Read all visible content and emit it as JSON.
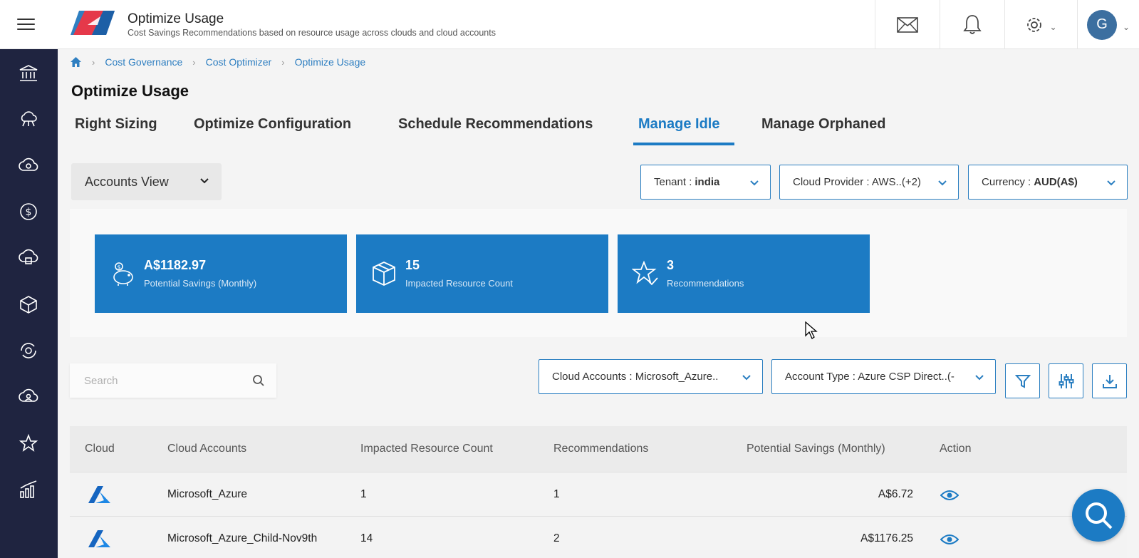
{
  "header": {
    "title": "Optimize Usage",
    "subtitle": "Cost Savings Recommendations based on resource usage across clouds and cloud accounts",
    "avatar_initial": "G",
    "icons": [
      "menu-icon",
      "mail-icon",
      "bell-icon",
      "gear-icon",
      "chevron-down-icon"
    ]
  },
  "sidebar": {
    "items": [
      "bank-icon",
      "cloud-network-icon",
      "cloud-cog-icon",
      "dollar-icon",
      "cloud-lock-icon",
      "cube-icon",
      "cog-refresh-icon",
      "cloud-user-icon",
      "star-icon",
      "bar-chart-icon"
    ]
  },
  "breadcrumb": {
    "items": [
      "Cost Governance",
      "Cost Optimizer",
      "Optimize Usage"
    ]
  },
  "page": {
    "title": "Optimize Usage"
  },
  "tabs": [
    {
      "label": "Right Sizing",
      "active": false
    },
    {
      "label": "Optimize Configuration",
      "active": false
    },
    {
      "label": "Schedule Recommendations",
      "active": false
    },
    {
      "label": "Manage Idle",
      "active": true
    },
    {
      "label": "Manage Orphaned",
      "active": false
    }
  ],
  "view_select": {
    "value": "Accounts View"
  },
  "filters": {
    "tenant_label": "Tenant :",
    "tenant_value": "india",
    "provider_label": "Cloud Provider : AWS..(+2)",
    "currency_label": "Currency :",
    "currency_value": "AUD(A$)",
    "cloud_accounts_label": "Cloud Accounts : Microsoft_Azure..",
    "account_type_label": "Account Type : Azure CSP Direct..(-"
  },
  "cards": [
    {
      "value": "A$1182.97",
      "label": "Potential Savings (Monthly)",
      "icon": "piggy-bank-icon"
    },
    {
      "value": "15",
      "label": "Impacted Resource Count",
      "icon": "box-icon"
    },
    {
      "value": "3",
      "label": "Recommendations",
      "icon": "star-check-icon"
    }
  ],
  "search": {
    "placeholder": "Search"
  },
  "table": {
    "columns": [
      "Cloud",
      "Cloud Accounts",
      "Impacted Resource Count",
      "Recommendations",
      "Potential Savings (Monthly)",
      "Action"
    ],
    "rows": [
      {
        "cloud": "azure-icon",
        "account": "Microsoft_Azure",
        "impacted": "1",
        "recommendations": "1",
        "savings": "A$6.72",
        "action": "view-icon"
      },
      {
        "cloud": "azure-icon",
        "account": "Microsoft_Azure_Child-Nov9th",
        "impacted": "14",
        "recommendations": "2",
        "savings": "A$1176.25",
        "action": "view-icon"
      }
    ]
  },
  "colors": {
    "accent": "#1c7bc4",
    "sidebar": "#1f2440",
    "card": "#1c7bc4"
  }
}
